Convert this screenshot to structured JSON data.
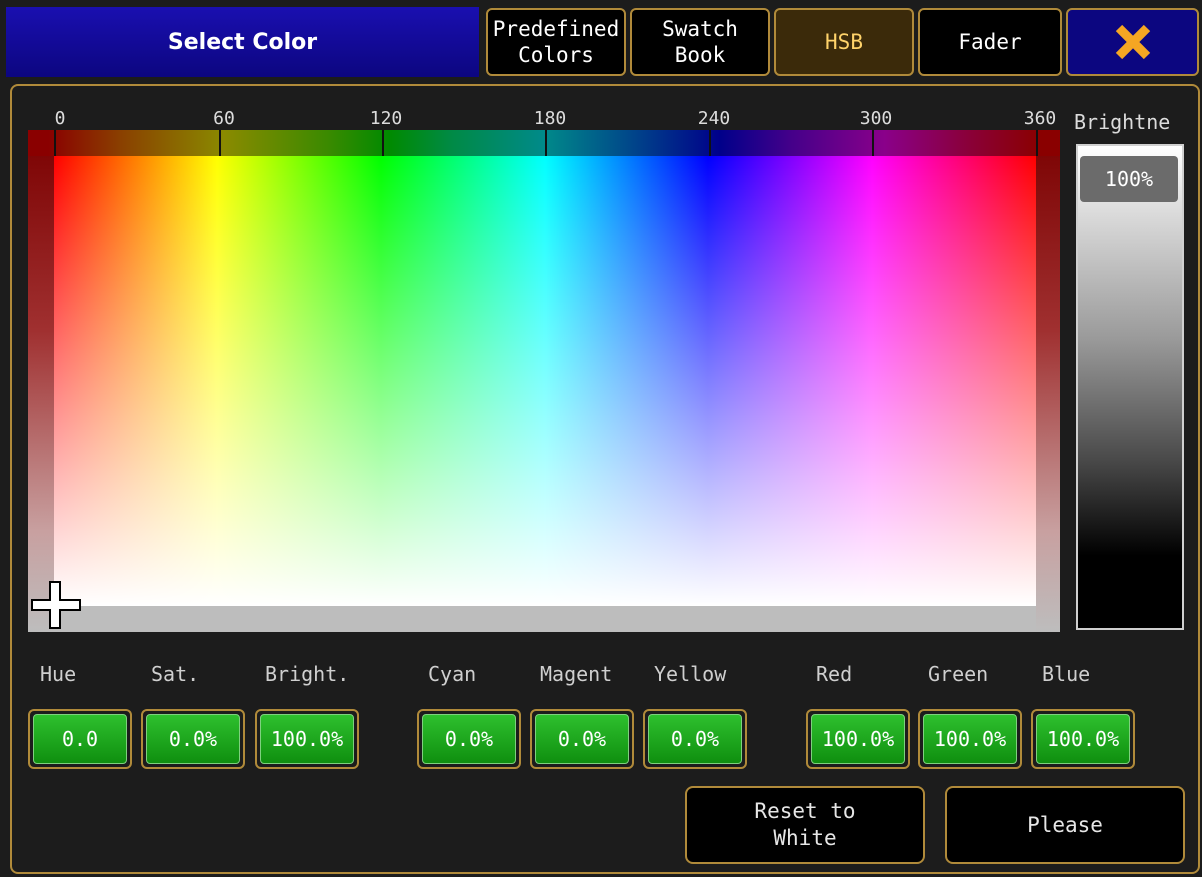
{
  "dialog": {
    "title": "Select Color"
  },
  "tabs": [
    {
      "label": "Predefined\nColors"
    },
    {
      "label": "Swatch\nBook"
    },
    {
      "label": "HSB",
      "active": true
    },
    {
      "label": "Fader"
    }
  ],
  "hue_scale": [
    "0",
    "60",
    "120",
    "180",
    "240",
    "300",
    "360"
  ],
  "brightness": {
    "label": "Brightne",
    "value": "100%"
  },
  "fields": {
    "hue": {
      "label": "Hue",
      "value": "0.0"
    },
    "sat": {
      "label": "Sat.",
      "value": "0.0%"
    },
    "bright": {
      "label": "Bright.",
      "value": "100.0%"
    },
    "cyan": {
      "label": "Cyan",
      "value": "0.0%"
    },
    "magenta": {
      "label": "Magent",
      "value": "0.0%"
    },
    "yellow": {
      "label": "Yellow",
      "value": "0.0%"
    },
    "red": {
      "label": "Red",
      "value": "100.0%"
    },
    "green": {
      "label": "Green",
      "value": "100.0%"
    },
    "blue": {
      "label": "Blue",
      "value": "100.0%"
    }
  },
  "buttons": {
    "reset": "Reset to\nWhite",
    "please": "Please"
  },
  "colors": {
    "accent_border": "#b08a3a",
    "title_bg": "#0c0680",
    "field_green": "#1fa81f",
    "close_icon": "#f5a623"
  }
}
